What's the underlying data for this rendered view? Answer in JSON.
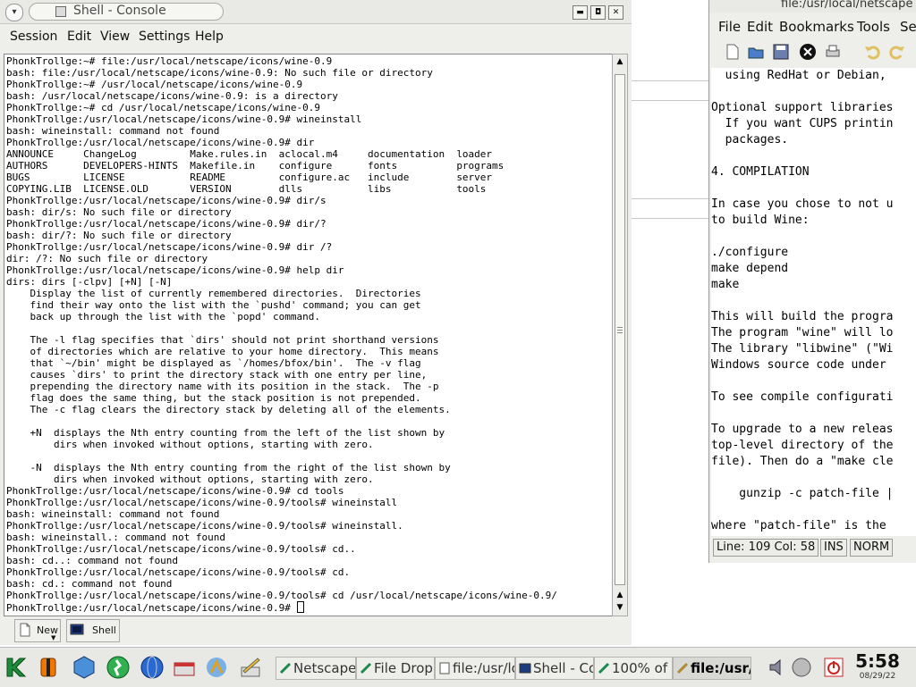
{
  "konsole": {
    "title": "Shell - Console",
    "menu": [
      "Session",
      "Edit",
      "View",
      "Settings",
      "Help"
    ],
    "terminal_lines": [
      "PhonkTrollge:~# file:/usr/local/netscape/icons/wine-0.9",
      "bash: file:/usr/local/netscape/icons/wine-0.9: No such file or directory",
      "PhonkTrollge:~# /usr/local/netscape/icons/wine-0.9",
      "bash: /usr/local/netscape/icons/wine-0.9: is a directory",
      "PhonkTrollge:~# cd /usr/local/netscape/icons/wine-0.9",
      "PhonkTrollge:/usr/local/netscape/icons/wine-0.9# wineinstall",
      "bash: wineinstall: command not found",
      "PhonkTrollge:/usr/local/netscape/icons/wine-0.9# dir",
      "ANNOUNCE     ChangeLog         Make.rules.in  aclocal.m4     documentation  loader",
      "AUTHORS      DEVELOPERS-HINTS  Makefile.in    configure      fonts          programs",
      "BUGS         LICENSE           README         configure.ac   include        server",
      "COPYING.LIB  LICENSE.OLD       VERSION        dlls           libs           tools",
      "PhonkTrollge:/usr/local/netscape/icons/wine-0.9# dir/s",
      "bash: dir/s: No such file or directory",
      "PhonkTrollge:/usr/local/netscape/icons/wine-0.9# dir/?",
      "bash: dir/?: No such file or directory",
      "PhonkTrollge:/usr/local/netscape/icons/wine-0.9# dir /?",
      "dir: /?: No such file or directory",
      "PhonkTrollge:/usr/local/netscape/icons/wine-0.9# help dir",
      "dirs: dirs [-clpv] [+N] [-N]",
      "    Display the list of currently remembered directories.  Directories",
      "    find their way onto the list with the `pushd' command; you can get",
      "    back up through the list with the `popd' command.",
      "",
      "    The -l flag specifies that `dirs' should not print shorthand versions",
      "    of directories which are relative to your home directory.  This means",
      "    that `~/bin' might be displayed as `/homes/bfox/bin'.  The -v flag",
      "    causes `dirs' to print the directory stack with one entry per line,",
      "    prepending the directory name with its position in the stack.  The -p",
      "    flag does the same thing, but the stack position is not prepended.",
      "    The -c flag clears the directory stack by deleting all of the elements.",
      "",
      "    +N  displays the Nth entry counting from the left of the list shown by",
      "        dirs when invoked without options, starting with zero.",
      "",
      "    -N  displays the Nth entry counting from the right of the list shown by",
      "        dirs when invoked without options, starting with zero.",
      "PhonkTrollge:/usr/local/netscape/icons/wine-0.9# cd tools",
      "PhonkTrollge:/usr/local/netscape/icons/wine-0.9/tools# wineinstall",
      "bash: wineinstall: command not found",
      "PhonkTrollge:/usr/local/netscape/icons/wine-0.9/tools# wineinstall.",
      "bash: wineinstall.: command not found",
      "PhonkTrollge:/usr/local/netscape/icons/wine-0.9/tools# cd..",
      "bash: cd..: command not found",
      "PhonkTrollge:/usr/local/netscape/icons/wine-0.9/tools# cd.",
      "bash: cd.: command not found",
      "PhonkTrollge:/usr/local/netscape/icons/wine-0.9/tools# cd /usr/local/netscape/icons/wine-0.9/"
    ],
    "prompt_line": "PhonkTrollge:/usr/local/netscape/icons/wine-0.9# ",
    "sessions": [
      {
        "label": "New",
        "icon": "new-session-icon"
      },
      {
        "label": "Shell",
        "icon": "terminal-icon"
      }
    ]
  },
  "editor": {
    "title": "file:/usr/local/netscape",
    "menu": [
      "File",
      "Edit",
      "Bookmarks",
      "Tools",
      "Se"
    ],
    "text_lines": [
      "  using RedHat or Debian,",
      "",
      "Optional support libraries",
      "  If you want CUPS printin",
      "  packages.",
      "",
      "4. COMPILATION",
      "",
      "In case you chose to not u",
      "to build Wine:",
      "",
      "./configure",
      "make depend",
      "make",
      "",
      "This will build the progra",
      "The program \"wine\" will lo",
      "The library \"libwine\" (\"Wi",
      "Windows source code under",
      "",
      "To see compile configurati",
      "",
      "To upgrade to a new releas",
      "top-level directory of the",
      "file). Then do a \"make cle",
      "",
      "    gunzip -c patch-file |",
      "",
      "where \"patch-file\" is the"
    ],
    "status": {
      "position": "Line: 109 Col: 58",
      "ins": "INS",
      "norm": "NORM"
    }
  },
  "taskbar": {
    "tasks": [
      {
        "label": "Netscape",
        "icon": "netscape-icon"
      },
      {
        "label": "File Drop",
        "icon": "netscape-icon"
      },
      {
        "label": "file:/usr/lo",
        "icon": "document-icon"
      },
      {
        "label": "Shell - Co",
        "icon": "terminal-icon"
      },
      {
        "label": "100% of",
        "icon": "netscape-icon"
      },
      {
        "label": "file:/usr/",
        "icon": "editor-icon",
        "active": true
      }
    ],
    "clock": {
      "time": "5:58",
      "date": "08/29/22"
    }
  }
}
